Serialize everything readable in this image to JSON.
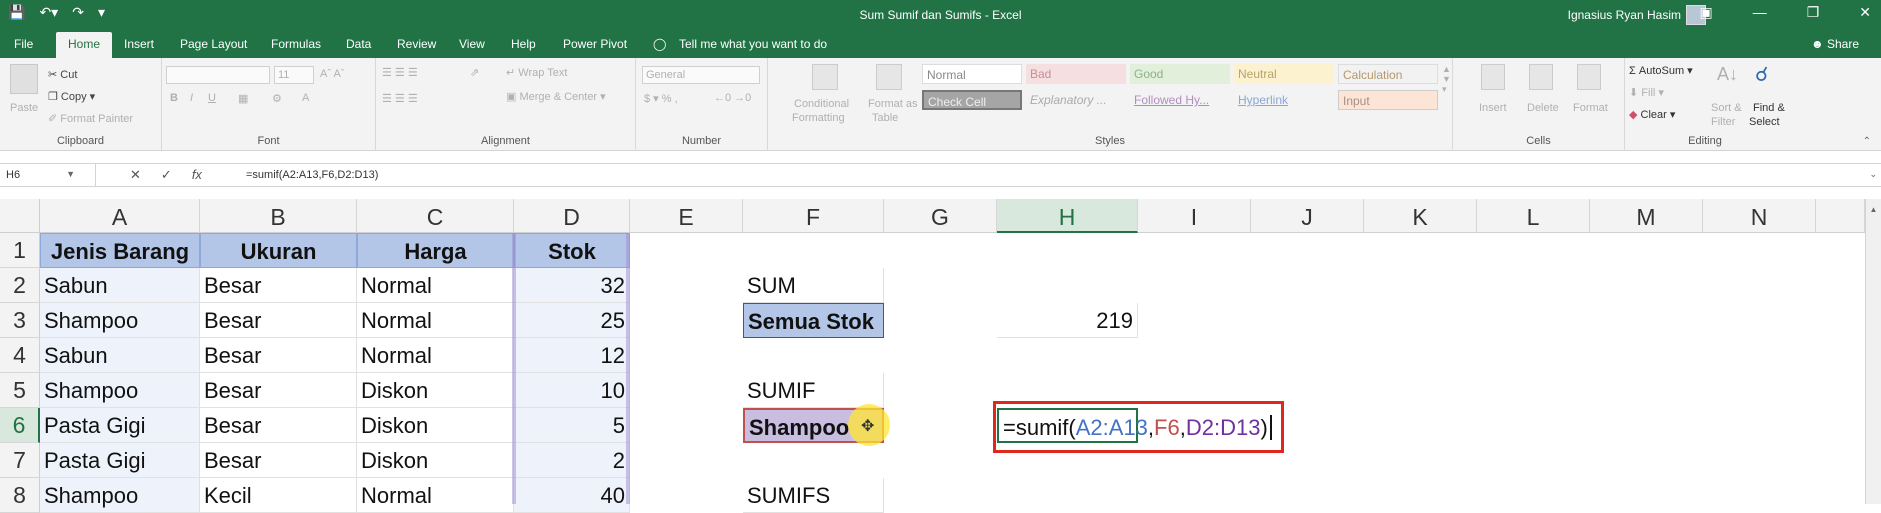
{
  "app": {
    "title": "Sum Sumif dan Sumifs  -  Excel",
    "user": "Ignasius Ryan Hasim"
  },
  "tabs": [
    "File",
    "Home",
    "Insert",
    "Page Layout",
    "Formulas",
    "Data",
    "Review",
    "View",
    "Help",
    "Power Pivot"
  ],
  "tell_me": "Tell me what you want to do",
  "share": "Share",
  "ribbon": {
    "clipboard": {
      "paste": "Paste",
      "cut": "Cut",
      "copy": "Copy",
      "format_painter": "Format Painter",
      "label": "Clipboard"
    },
    "font": {
      "size": "11",
      "label": "Font"
    },
    "alignment": {
      "wrap": "Wrap Text",
      "merge": "Merge & Center",
      "label": "Alignment"
    },
    "number": {
      "format": "General",
      "label": "Number"
    },
    "styles": {
      "conditional": "Conditional",
      "formatting": "Formatting",
      "format_as": "Format as",
      "table": "Table",
      "label": "Styles",
      "cells": [
        "Normal",
        "Bad",
        "Good",
        "Neutral",
        "Calculation",
        "Check Cell",
        "Explanatory ...",
        "Followed Hy...",
        "Hyperlink",
        "Input"
      ]
    },
    "cells": {
      "insert": "Insert",
      "delete": "Delete",
      "format": "Format",
      "label": "Cells"
    },
    "editing": {
      "autosum": "AutoSum",
      "fill": "Fill",
      "clear": "Clear",
      "sort": "Sort &",
      "filter": "Filter",
      "find": "Find &",
      "select": "Select",
      "label": "Editing"
    }
  },
  "formula_bar": {
    "name_box": "H6",
    "formula": "=sumif(A2:A13,F6,D2:D13)"
  },
  "columns": [
    "A",
    "B",
    "C",
    "D",
    "E",
    "F",
    "G",
    "H",
    "I",
    "J",
    "K",
    "L",
    "M",
    "N"
  ],
  "rows": [
    "1",
    "2",
    "3",
    "4",
    "5",
    "6",
    "7",
    "8"
  ],
  "table": {
    "headers": [
      "Jenis Barang",
      "Ukuran",
      "Harga",
      "Stok"
    ],
    "data": [
      [
        "Sabun",
        "Besar",
        "Normal",
        "32"
      ],
      [
        "Shampoo",
        "Besar",
        "Normal",
        "25"
      ],
      [
        "Sabun",
        "Besar",
        "Normal",
        "12"
      ],
      [
        "Shampoo",
        "Besar",
        "Diskon",
        "10"
      ],
      [
        "Pasta Gigi",
        "Besar",
        "Diskon",
        "5"
      ],
      [
        "Pasta Gigi",
        "Besar",
        "Diskon",
        "2"
      ],
      [
        "Shampoo",
        "Kecil",
        "Normal",
        "40"
      ]
    ]
  },
  "f_column": {
    "f2": "SUM",
    "f3": "Semua Stok",
    "f5": "SUMIF",
    "f6": "Shampoo",
    "f8": "SUMIFS"
  },
  "h3": "219",
  "editing_formula": {
    "prefix": "=sumif(",
    "range1": "A2:A13",
    "sep1": ",",
    "crit": "F6",
    "sep2": ",",
    "range2": "D2:D13",
    "suffix": ")"
  },
  "colors": {
    "excel_green": "#217346",
    "header_fill": "#b4c6e7",
    "ref_blue": "#4472c4",
    "ref_red": "#c0504d",
    "ref_purple": "#7030a0",
    "highlight_red": "#e1261c"
  }
}
